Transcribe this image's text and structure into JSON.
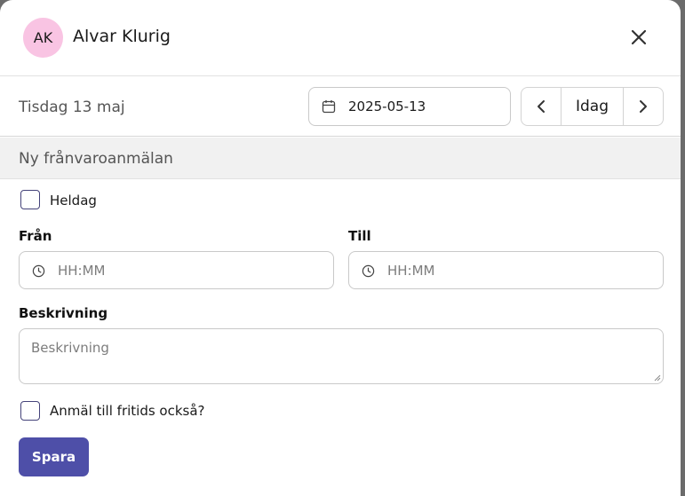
{
  "header": {
    "avatar_initials": "AK",
    "name": "Alvar Klurig",
    "close_icon": "close-icon"
  },
  "datebar": {
    "day_label": "Tisdag 13 maj",
    "date_value": "2025-05-13",
    "calendar_icon": "calendar-icon",
    "today_label": "Idag",
    "prev_icon": "chevron-left-icon",
    "next_icon": "chevron-right-icon"
  },
  "section": {
    "title": "Ny frånvaroanmälan"
  },
  "form": {
    "all_day_label": "Heldag",
    "all_day_checked": false,
    "from_label": "Från",
    "from_placeholder": "HH:MM",
    "to_label": "Till",
    "to_placeholder": "HH:MM",
    "clock_icon": "clock-icon",
    "description_label": "Beskrivning",
    "description_placeholder": "Beskrivning",
    "afterschool_label": "Anmäl till fritids också?",
    "afterschool_checked": false,
    "save_label": "Spara"
  },
  "colors": {
    "accent": "#4e4fa8",
    "avatar_bg": "#f9c4e3",
    "checkbox_border": "#45437a"
  }
}
